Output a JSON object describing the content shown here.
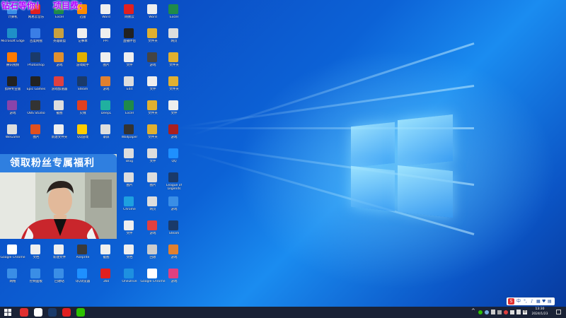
{
  "banner": {
    "left_text": "钻石等你！",
    "right_text": "项目费："
  },
  "webcam": {
    "title": "领取粉丝专属福利"
  },
  "desktop_icons": [
    {
      "label": "计算机",
      "color": "#3a8ee6"
    },
    {
      "label": "Microsoft Edge",
      "color": "#1e90c8"
    },
    {
      "label": "腾讯视频",
      "color": "#ff7a00"
    },
    {
      "label": "剪映专业版",
      "color": "#222222"
    },
    {
      "label": "游戏",
      "color": "#8844aa"
    },
    {
      "label": "WeGame",
      "color": "#dddddd"
    },
    {
      "label": "Google Chrome",
      "color": "#ffffff"
    },
    {
      "label": "网络",
      "color": "#3a8ee6"
    },
    {
      "label": "网易云音乐",
      "color": "#e02020"
    },
    {
      "label": "百度网盘",
      "color": "#3a7ee6"
    },
    {
      "label": "Photoshop",
      "color": "#1a3a6a"
    },
    {
      "label": "Epic Games",
      "color": "#222222"
    },
    {
      "label": "OBS Studio",
      "color": "#333333"
    },
    {
      "label": "图片",
      "color": "#e05020"
    },
    {
      "label": "文档",
      "color": "#eeeeee"
    },
    {
      "label": "控制面板",
      "color": "#3a8ee6"
    },
    {
      "label": "Excel",
      "color": "#1f8a4a"
    },
    {
      "label": "英雄联盟",
      "color": "#c8a040"
    },
    {
      "label": "游戏",
      "color": "#e09030"
    },
    {
      "label": "游戏加速器",
      "color": "#e04040"
    },
    {
      "label": "截图",
      "color": "#dddddd"
    },
    {
      "label": "新建文件夹",
      "color": "#eeeeee"
    },
    {
      "label": "新建文件",
      "color": "#eeeeee"
    },
    {
      "label": "回收站",
      "color": "#3a8ee6"
    },
    {
      "label": "迅雷",
      "color": "#ff8a00"
    },
    {
      "label": "记事本",
      "color": "#eeeeee"
    },
    {
      "label": "游戏助手",
      "color": "#e0b000"
    },
    {
      "label": "Steam",
      "color": "#1a3a6a"
    },
    {
      "label": "火绒",
      "color": "#e04020"
    },
    {
      "label": "QQ游戏",
      "color": "#ffcc00"
    },
    {
      "label": "Aseprite",
      "color": "#3a3a3a"
    },
    {
      "label": "QQ浏览器",
      "color": "#1e90ff"
    },
    {
      "label": "Word",
      "color": "#eeeeee"
    },
    {
      "label": "PPT",
      "color": "#eeeeee"
    },
    {
      "label": "图片",
      "color": "#eeeeee"
    },
    {
      "label": "游戏",
      "color": "#e08030"
    },
    {
      "label": "DeepL",
      "color": "#20b0a0"
    },
    {
      "label": "录屏",
      "color": "#dddddd"
    },
    {
      "label": "截图",
      "color": "#eeeeee"
    },
    {
      "label": "360",
      "color": "#e02020"
    },
    {
      "label": "网易云",
      "color": "#e02020"
    },
    {
      "label": "直播伴侣",
      "color": "#222222"
    },
    {
      "label": "文件",
      "color": "#eeeeee"
    },
    {
      "label": "Edit",
      "color": "#dddddd"
    },
    {
      "label": "Excel",
      "color": "#1f8a4a"
    },
    {
      "label": "Wallpaper",
      "color": "#333333"
    },
    {
      "label": "Blog",
      "color": "#dddddd"
    },
    {
      "label": "图片",
      "color": "#dddddd"
    },
    {
      "label": "Chrome",
      "color": "#1ea0e0"
    },
    {
      "label": "文件",
      "color": "#eeeeee"
    },
    {
      "label": "文档",
      "color": "#eeeeee"
    },
    {
      "label": "OneDrive",
      "color": "#1e90e0"
    },
    {
      "label": "Word",
      "color": "#eeeeee"
    },
    {
      "label": "文件夹",
      "color": "#e0b030"
    },
    {
      "label": "游戏",
      "color": "#444444"
    },
    {
      "label": "文件",
      "color": "#eeeeee"
    },
    {
      "label": "文件夹",
      "color": "#e0b030"
    },
    {
      "label": "文件夹",
      "color": "#e0b030"
    },
    {
      "label": "文件",
      "color": "#dddddd"
    },
    {
      "label": "图片",
      "color": "#dddddd"
    },
    {
      "label": "网页",
      "color": "#dddddd"
    },
    {
      "label": "游戏",
      "color": "#e04040"
    },
    {
      "label": "回收",
      "color": "#cccccc"
    },
    {
      "label": "Google Chrome",
      "color": "#ffffff"
    },
    {
      "label": "Excel",
      "color": "#1f8a4a"
    },
    {
      "label": "网页",
      "color": "#dddddd"
    },
    {
      "label": "文件夹",
      "color": "#e0b030"
    },
    {
      "label": "文件夹",
      "color": "#e0b030"
    },
    {
      "label": "文件",
      "color": "#eeeeee"
    },
    {
      "label": "游戏",
      "color": "#aa2020"
    },
    {
      "label": "QQ",
      "color": "#1e90ff"
    },
    {
      "label": "League of Legends",
      "color": "#1a3a6a"
    },
    {
      "label": "游戏",
      "color": "#3a8ee6"
    },
    {
      "label": "Steam",
      "color": "#1a3a6a"
    },
    {
      "label": "游戏",
      "color": "#e08030"
    },
    {
      "label": "游戏",
      "color": "#e04080"
    },
    {
      "label": "Steam",
      "color": "#1a3a6a"
    },
    {
      "label": "游戏",
      "color": "#222222"
    }
  ],
  "taskbar": {
    "apps": [
      {
        "name": "wps-icon",
        "color": "#e03030"
      },
      {
        "name": "chrome-icon",
        "color": "#ffffff"
      },
      {
        "name": "steam-icon",
        "color": "#1a3a6a"
      },
      {
        "name": "netease-music-icon",
        "color": "#e02020"
      },
      {
        "name": "wechat-icon",
        "color": "#2dc100"
      }
    ],
    "time": "13:30",
    "date": "2024/1/23"
  },
  "ime": {
    "lang": "中"
  },
  "colors": {
    "accent": "#2f7fe0",
    "banner_text": "#b000ff",
    "taskbar": "#1a2236"
  }
}
